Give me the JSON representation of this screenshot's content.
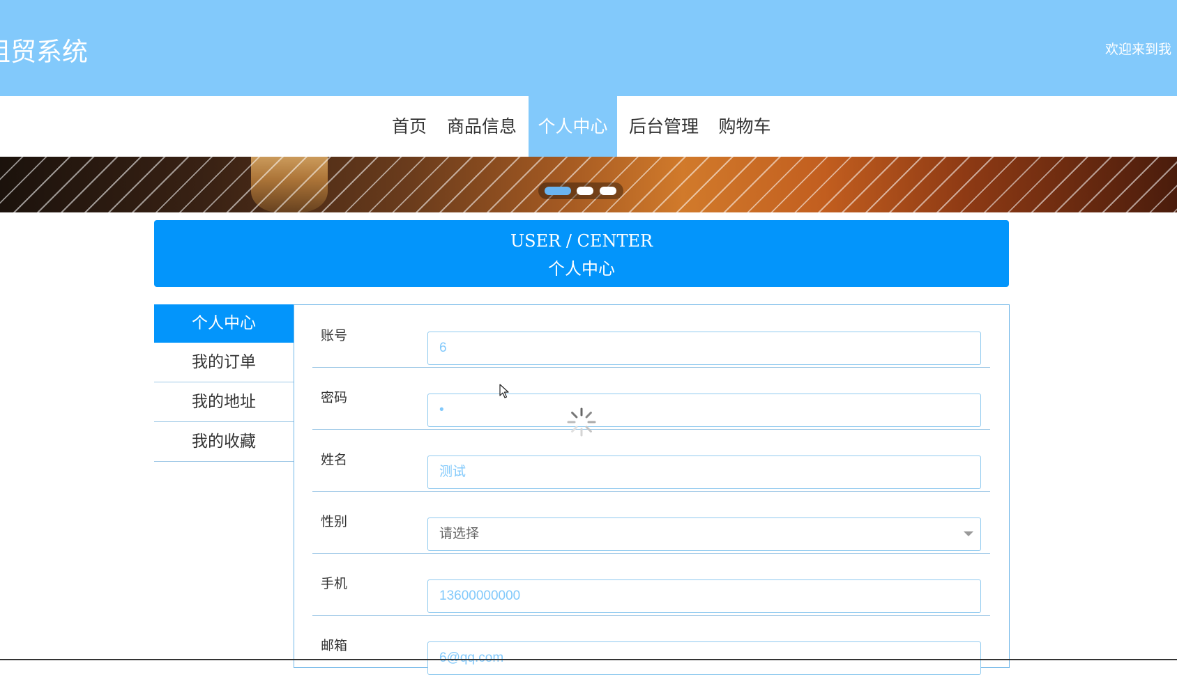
{
  "header": {
    "site_title": "租贸系统",
    "welcome": "欢迎来到我"
  },
  "nav": {
    "items": [
      {
        "label": "首页",
        "active": false
      },
      {
        "label": "商品信息",
        "active": false
      },
      {
        "label": "个人中心",
        "active": true
      },
      {
        "label": "后台管理",
        "active": false
      },
      {
        "label": "购物车",
        "active": false
      }
    ]
  },
  "banner": {
    "slides": 3,
    "active_slide": 1
  },
  "center_header": {
    "en": "USER / CENTER",
    "cn": "个人中心"
  },
  "sidebar": {
    "items": [
      {
        "label": "个人中心",
        "active": true
      },
      {
        "label": "我的订单",
        "active": false
      },
      {
        "label": "我的地址",
        "active": false
      },
      {
        "label": "我的收藏",
        "active": false
      }
    ]
  },
  "form": {
    "fields": [
      {
        "label": "账号",
        "value": "6"
      },
      {
        "label": "密码",
        "value": "•"
      },
      {
        "label": "姓名",
        "value": "测试"
      },
      {
        "label": "性别",
        "value": "请选择"
      },
      {
        "label": "手机",
        "value": "13600000000"
      },
      {
        "label": "邮箱",
        "value": "6@qq.com"
      }
    ]
  },
  "colors": {
    "header_bg": "#82c9fb",
    "primary": "#0395fb",
    "input_text": "#82c9fb"
  }
}
